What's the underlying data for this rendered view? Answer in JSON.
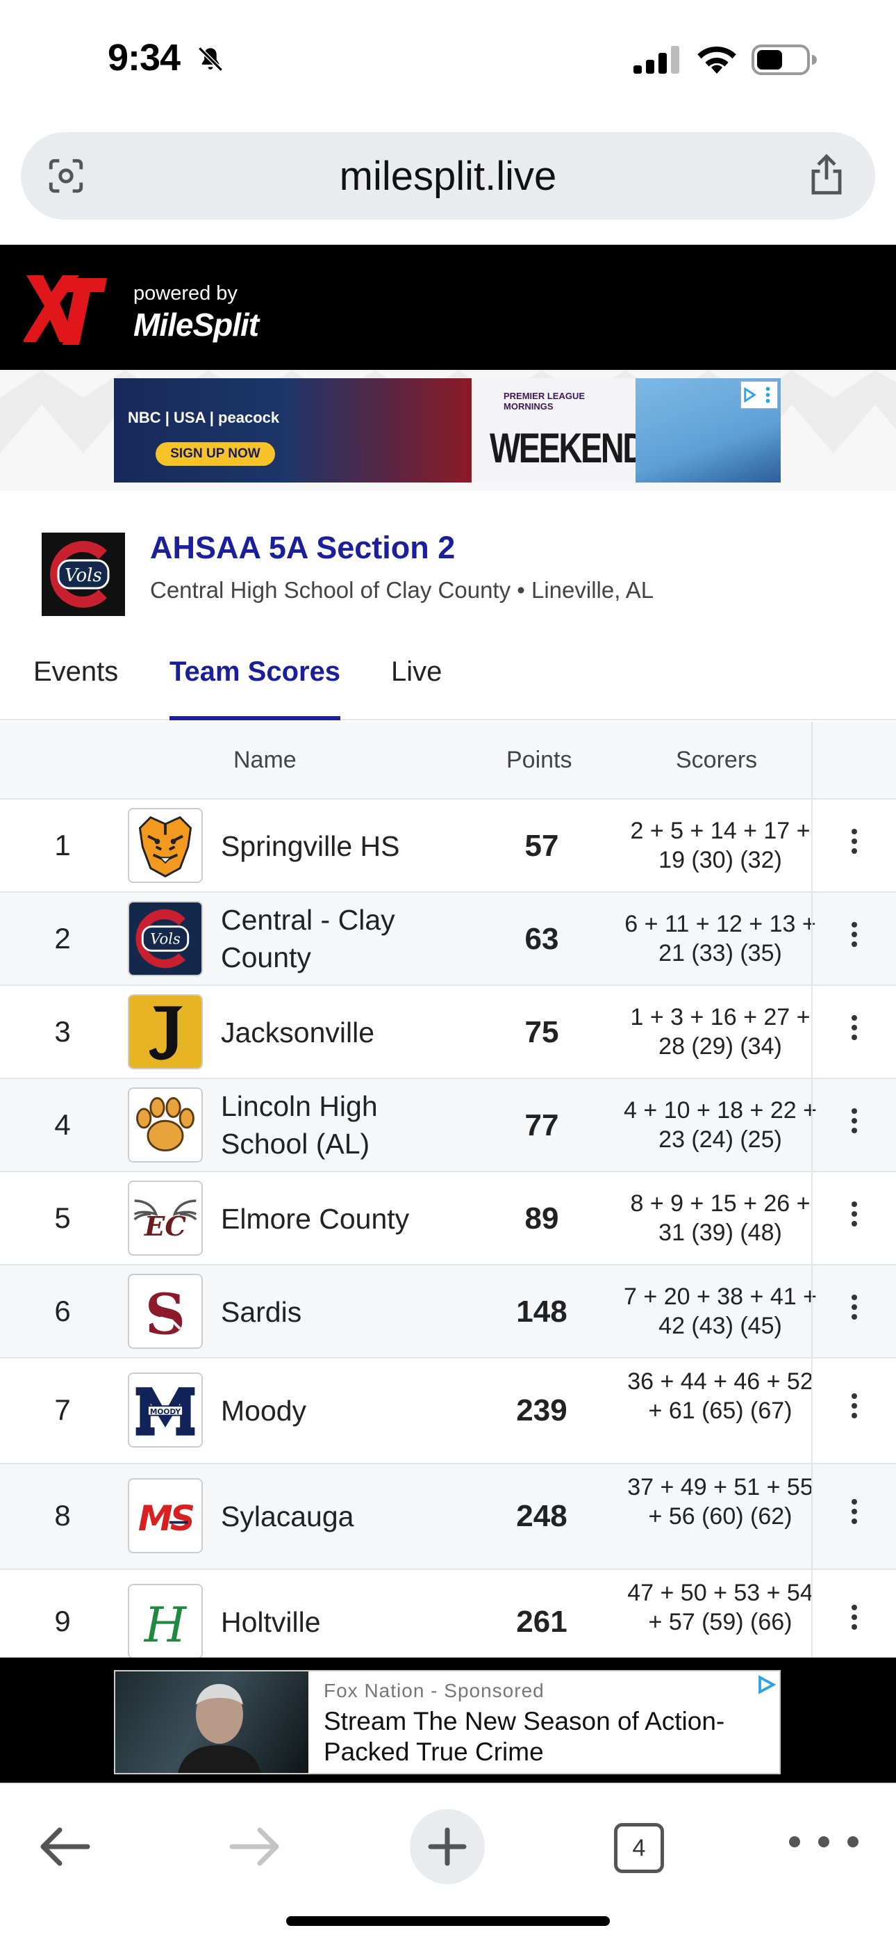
{
  "status_bar": {
    "time": "9:34",
    "icons": [
      "bell-slash-icon",
      "signal-icon",
      "wifi-icon",
      "battery-icon"
    ]
  },
  "browser": {
    "url": "milesplit.live",
    "toolbar": {
      "tab_count": "4",
      "icons": [
        "back-arrow-icon",
        "forward-arrow-icon",
        "plus-icon",
        "tabs-icon",
        "more-icon"
      ]
    }
  },
  "site_header": {
    "powered_by": "powered by",
    "brand": "MileSplit"
  },
  "top_ad": {
    "brand_line": "NBC | USA | peacock",
    "cta": "SIGN UP NOW",
    "league_line": "PREMIER LEAGUE MORNINGS",
    "headline": "WEEKENDS"
  },
  "meet": {
    "title": "AHSAA 5A Section 2",
    "subtitle": "Central High School of Clay County • Lineville, AL"
  },
  "tabs": [
    {
      "label": "Events",
      "active": false
    },
    {
      "label": "Team Scores",
      "active": true
    },
    {
      "label": "Live",
      "active": false
    }
  ],
  "table": {
    "columns": {
      "name": "Name",
      "points": "Points",
      "scorers": "Scorers"
    },
    "rows": [
      {
        "rank": "1",
        "name": "Springville HS",
        "points": "57",
        "scorers": "2 + 5 + 14 + 17 + 19 (30) (32)",
        "logo": "tiger-logo"
      },
      {
        "rank": "2",
        "name": "Central - Clay County",
        "points": "63",
        "scorers": "6 + 11 + 12 + 13 + 21 (33) (35)",
        "logo": "vols-logo"
      },
      {
        "rank": "3",
        "name": "Jacksonville",
        "points": "75",
        "scorers": "1 + 3 + 16 + 27 + 28 (29) (34)",
        "logo": "j-logo"
      },
      {
        "rank": "4",
        "name": "Lincoln High School (AL)",
        "points": "77",
        "scorers": "4 + 10 + 18 + 22 + 23 (24) (25)",
        "logo": "paw-logo"
      },
      {
        "rank": "5",
        "name": "Elmore County",
        "points": "89",
        "scorers": "8 + 9 + 15 + 26 + 31 (39) (48)",
        "logo": "ec-wings-logo"
      },
      {
        "rank": "6",
        "name": "Sardis",
        "points": "148",
        "scorers": "7 + 20 + 38 + 41 + 42 (43) (45)",
        "logo": "s-lion-logo"
      },
      {
        "rank": "7",
        "name": "Moody",
        "points": "239",
        "scorers": "36 + 44 + 46 + 52 + 61 (65) (67)",
        "logo": "m-moody-logo"
      },
      {
        "rank": "8",
        "name": "Sylacauga",
        "points": "248",
        "scorers": "37 + 49 + 51 + 55 + 56 (60) (62)",
        "logo": "ms-logo"
      },
      {
        "rank": "9",
        "name": "Holtville",
        "points": "261",
        "scorers": "47 + 50 + 53 + 54 + 57 (59) (66)",
        "logo": "h-logo"
      }
    ]
  },
  "bottom_ad": {
    "sponsor_line": "Fox Nation  -  Sponsored",
    "text": "Stream The New Season of Action-Packed True Crime"
  },
  "colors": {
    "accent": "#1b1f9c",
    "header_bg": "#000000",
    "row_alt": "#f6f7f9"
  }
}
